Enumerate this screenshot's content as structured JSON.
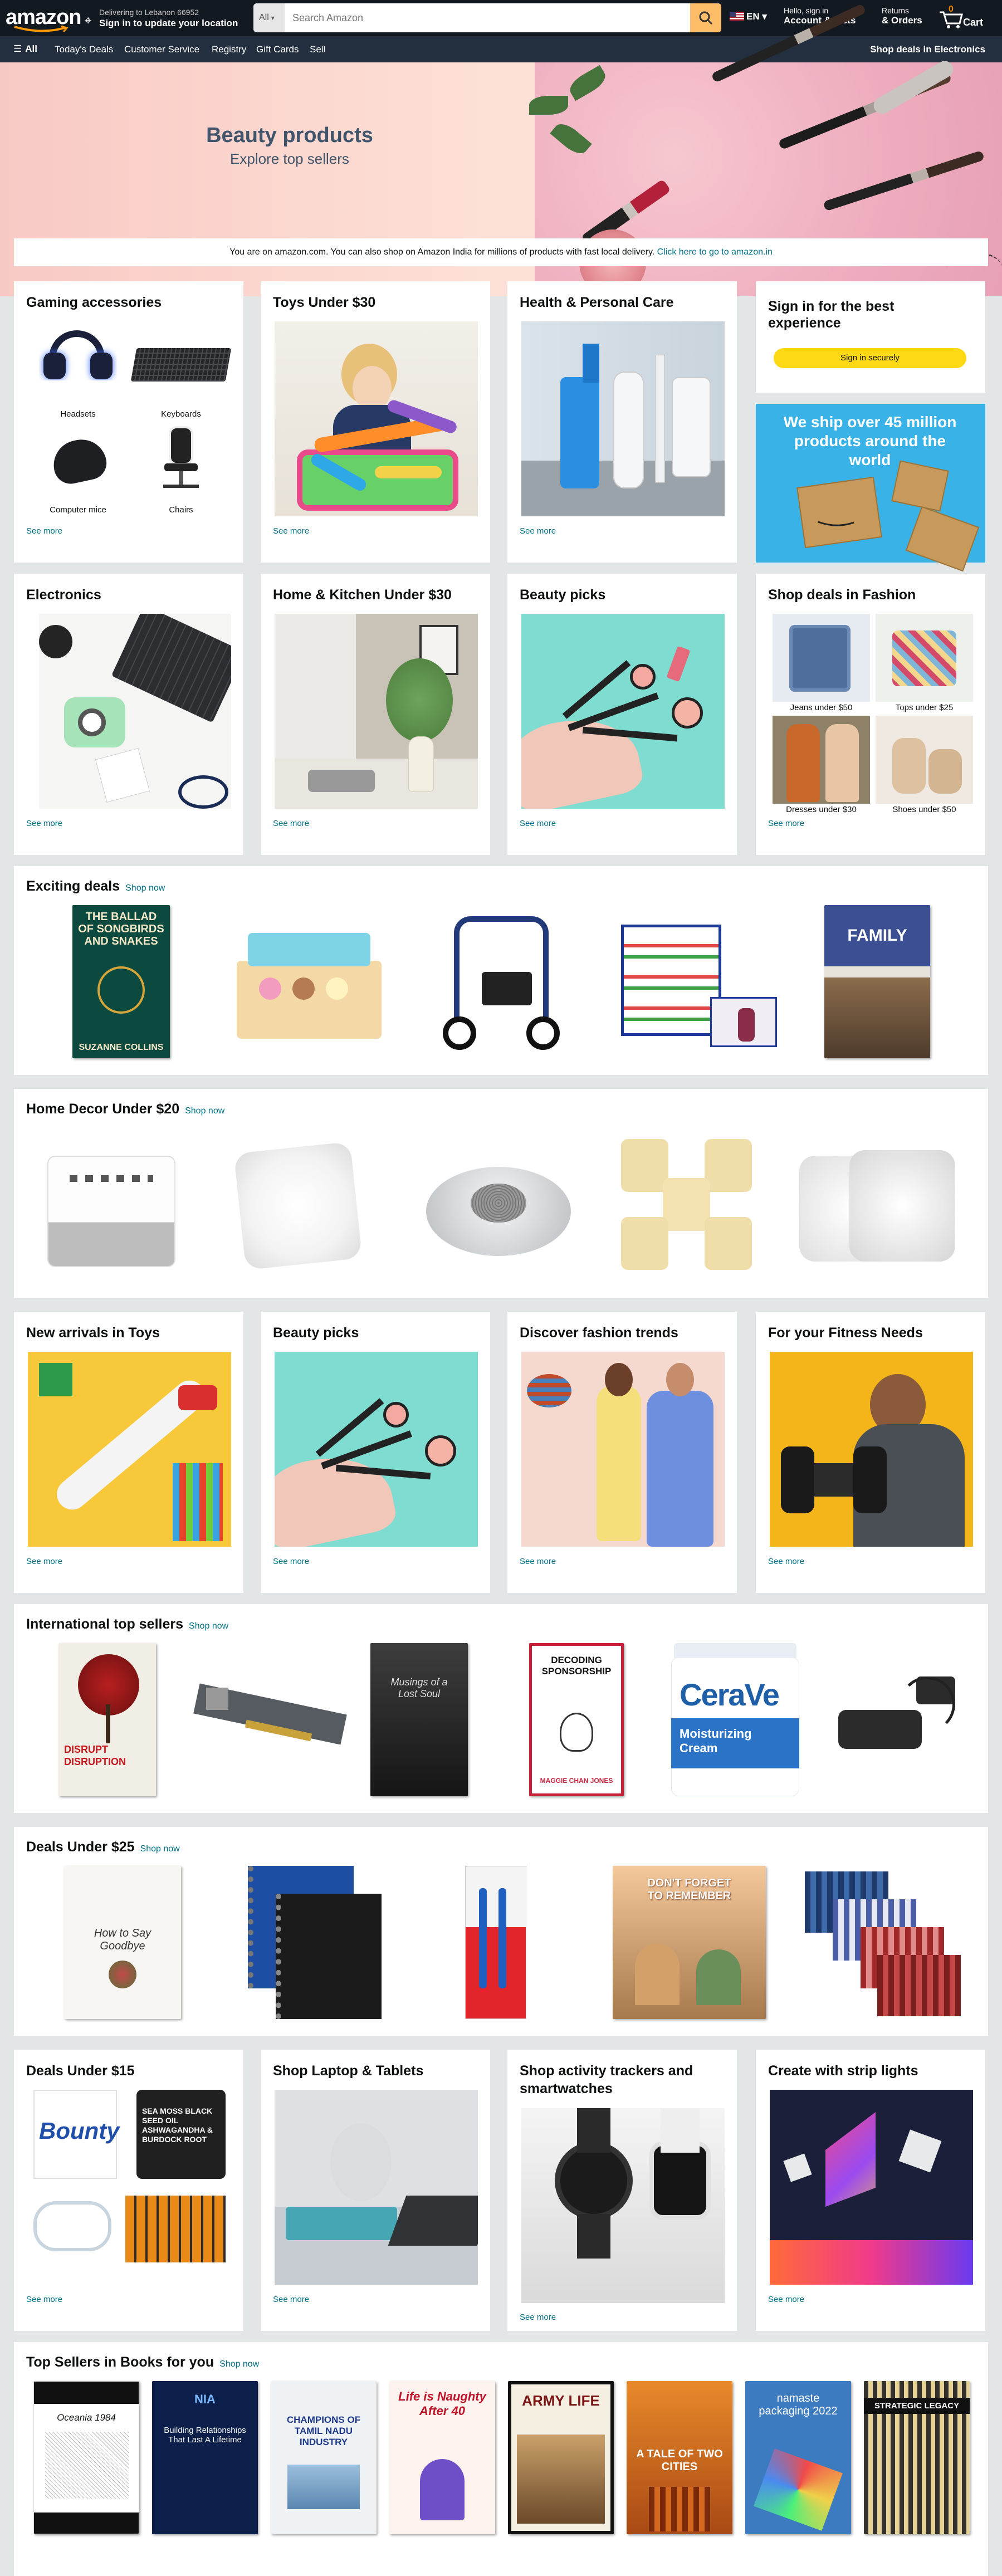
{
  "header": {
    "logo": "amazon",
    "deliver_line1": "Delivering to Lebanon 66952",
    "deliver_line2": "Sign in to update your location",
    "search_category": "All",
    "search_placeholder": "Search Amazon",
    "language": "EN",
    "account_line1": "Hello, sign in",
    "account_line2": "Account & Lists",
    "returns_line1": "Returns",
    "returns_line2": "& Orders",
    "cart_count": "0",
    "cart_label": "Cart"
  },
  "nav": {
    "all": "All",
    "items": [
      "Today's Deals",
      "Customer Service",
      "Registry",
      "Gift Cards",
      "Sell"
    ],
    "right": "Shop deals in Electronics"
  },
  "hero": {
    "title": "Beauty products",
    "subtitle": "Explore top sellers"
  },
  "notice": {
    "text": "You are on amazon.com. You can also shop on Amazon India for millions of products with fast local delivery.",
    "link": "Click here to go to amazon.in"
  },
  "cards_row1": [
    {
      "title": "Gaming accessories",
      "items": [
        "Headsets",
        "Keyboards",
        "Computer mice",
        "Chairs"
      ],
      "see": "See more"
    },
    {
      "title": "Toys Under $30",
      "see": "See more"
    },
    {
      "title": "Health & Personal Care",
      "see": "See more"
    },
    {
      "title": "Sign in for the best experience",
      "button": "Sign in securely",
      "promo": "We ship over 45 million products around the world"
    }
  ],
  "cards_row2": [
    {
      "title": "Electronics",
      "see": "See more"
    },
    {
      "title": "Home & Kitchen Under $30",
      "see": "See more"
    },
    {
      "title": "Beauty picks",
      "see": "See more"
    },
    {
      "title": "Shop deals in Fashion",
      "items": [
        "Jeans under $50",
        "Tops under $25",
        "Dresses under $30",
        "Shoes under $50"
      ],
      "see": "See more"
    }
  ],
  "exciting": {
    "title": "Exciting deals",
    "link": "Shop now",
    "book_title": "THE BALLAD OF SONGBIRDS AND SNAKES",
    "book_author": "SUZANNE COLLINS",
    "family_book": "FAMILY"
  },
  "home_decor": {
    "title": "Home Decor Under $20",
    "link": "Shop now"
  },
  "cards_row3": [
    {
      "title": "New arrivals in Toys",
      "see": "See more"
    },
    {
      "title": "Beauty picks",
      "see": "See more"
    },
    {
      "title": "Discover fashion trends",
      "see": "See more"
    },
    {
      "title": "For your Fitness Needs",
      "see": "See more"
    }
  ],
  "intl": {
    "title": "International top sellers",
    "link": "Shop now",
    "books": [
      "DISRUPT DISRUPTION",
      "Musings of a Lost Soul",
      "DECODING SPONSORSHIP",
      "MAGGIE CHAN JONES"
    ],
    "cerave": "CeraVe",
    "cerave_sub": "Moisturizing Cream"
  },
  "deals25": {
    "title": "Deals Under $25",
    "link": "Shop now",
    "book": "How to Say Goodbye",
    "kids_book": "DON'T FORGET TO REMEMBER"
  },
  "cards_row4": [
    {
      "title": "Deals Under $15",
      "see": "See more",
      "bounty": "Bounty",
      "seamoss": "SEA MOSS BLACK SEED OIL ASHWAGANDHA & BURDOCK ROOT"
    },
    {
      "title": "Shop Laptop & Tablets",
      "see": "See more"
    },
    {
      "title": "Shop activity trackers and smartwatches",
      "see": "See more"
    },
    {
      "title": "Create with strip lights",
      "see": "See more"
    }
  ],
  "books_row": {
    "title": "Top Sellers in Books for you",
    "link": "Shop now",
    "books": [
      "Oceania 1984",
      "Building Relationships That Last A Lifetime",
      "CHAMPIONS OF TAMIL NADU INDUSTRY",
      "Life is Naughty After 40",
      "ARMY LIFE",
      "A TALE OF TWO CITIES",
      "namaste packaging 2022",
      "STRATEGIC LEGACY"
    ]
  },
  "colors": {
    "header": "#131921",
    "nav": "#232f3e",
    "search_button": "#febd69",
    "link": "#007185",
    "sign_button": "#ffd814",
    "promo": "#39b3e7"
  }
}
